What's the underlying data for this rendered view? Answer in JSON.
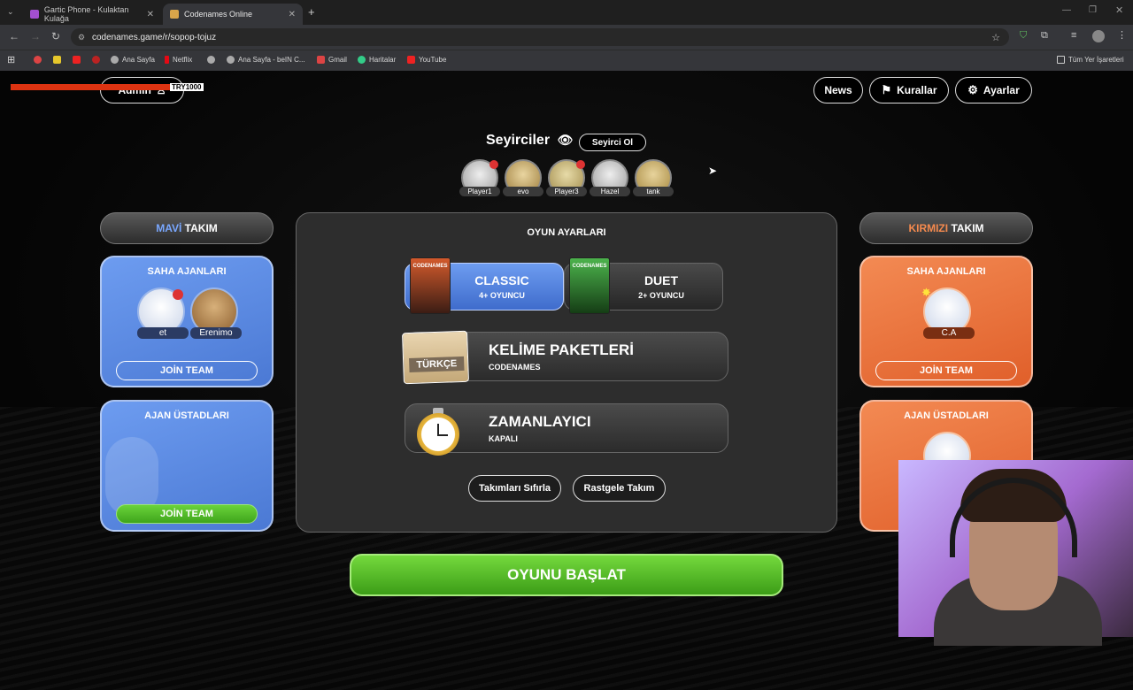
{
  "browser": {
    "tabs": [
      {
        "title": "Gartic Phone - Kulaktan Kulağa"
      },
      {
        "title": "Codenames Online"
      }
    ],
    "url": "codenames.game/r/sopop-tojuz",
    "bookmarks": [
      "Ana Sayfa",
      "Netflix",
      "Ana Sayfa - beIN C...",
      "Gmail",
      "Haritalar",
      "YouTube"
    ],
    "all_bookmarks": "Tüm Yer İşaretleri"
  },
  "header": {
    "admin": "Admin",
    "overlay_right": "TRY1000",
    "news": "News",
    "rules": "Kurallar",
    "settings": "Ayarlar"
  },
  "spectators": {
    "title": "Seyirciler",
    "become": "Seyirci Ol",
    "players": [
      "Player1",
      "evo",
      "Player3",
      "Hazel",
      "tank"
    ]
  },
  "blue_team": {
    "label_color_word": "MAVİ",
    "label_rest": "TAKIM",
    "operatives_title": "SAHA AJANLARI",
    "operatives": [
      "et",
      "Erenimo"
    ],
    "join_operatives": "JOİN TEAM",
    "spymasters_title": "AJAN ÜSTADLARI",
    "join_spymasters": "JOİN TEAM"
  },
  "red_team": {
    "label_color_word": "KIRMIZI",
    "label_rest": "TAKIM",
    "operatives_title": "SAHA AJANLARI",
    "operatives": [
      "C.A"
    ],
    "join_operatives": "JOİN TEAM",
    "spymasters_title": "AJAN ÜSTADLARI"
  },
  "settings_panel": {
    "title": "OYUN AYARLARI",
    "classic": {
      "name": "CLASSIC",
      "players": "4+ OYUNCU"
    },
    "duet": {
      "name": "DUET",
      "players": "2+ OYUNCU"
    },
    "box_label": "CODENAMES",
    "word_packs": {
      "title": "KELİME PAKETLERİ",
      "value": "CODENAMES",
      "badge": "TÜRKÇE"
    },
    "timer": {
      "title": "ZAMANLAYICI",
      "value": "KAPALI"
    },
    "reset_teams": "Takımları Sıfırla",
    "random_teams": "Rastgele Takım"
  },
  "start_button": "OYUNU BAŞLAT",
  "colors": {
    "blue": "#6d9cf0",
    "red": "#f38a53",
    "green": "#5cc52b"
  }
}
